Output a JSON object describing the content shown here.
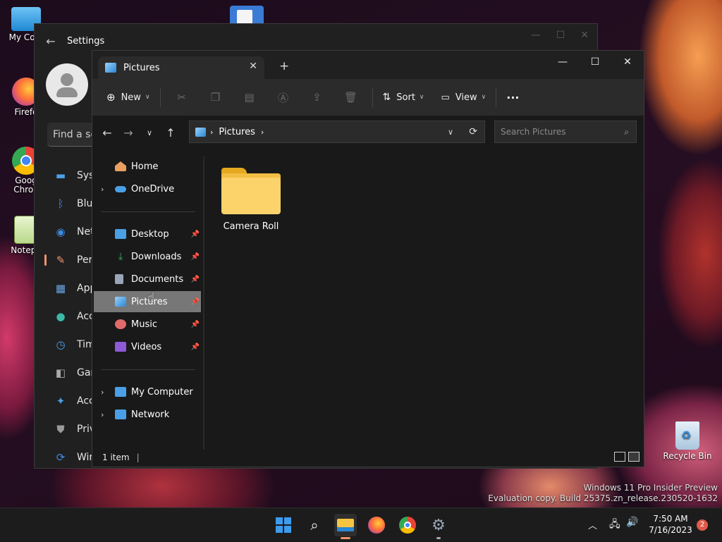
{
  "desktop": {
    "icons": [
      {
        "label": "My Com",
        "icon": "monitor-icon"
      },
      {
        "label": "Firefo",
        "icon": "firefox-icon"
      },
      {
        "label": "Goog Chron",
        "icon": "chrome-icon"
      },
      {
        "label": "Notepa",
        "icon": "notepad-icon"
      }
    ],
    "recycle_bin": "Recycle Bin",
    "watermark_line1": "Windows 11 Pro Insider Preview",
    "watermark_line2": "Evaluation copy. Build 25375.zn_release.230520-1632"
  },
  "settings": {
    "title": "Settings",
    "find_placeholder": "Find a se",
    "nav": [
      {
        "label": "Syst",
        "icon": "system-icon",
        "color": "#4aa0e6"
      },
      {
        "label": "Blue",
        "icon": "bluetooth-icon",
        "color": "#3b8be0"
      },
      {
        "label": "Net",
        "icon": "wifi-icon",
        "color": "#3b8be0"
      },
      {
        "label": "Pers",
        "icon": "brush-icon",
        "color": "#f0956c"
      },
      {
        "label": "App",
        "icon": "apps-icon",
        "color": "#6aa7e6"
      },
      {
        "label": "Acc",
        "icon": "account-icon",
        "color": "#3db8a8"
      },
      {
        "label": "Tim",
        "icon": "time-icon",
        "color": "#4aa0e6"
      },
      {
        "label": "Gan",
        "icon": "gaming-icon",
        "color": "#aaaaaa"
      },
      {
        "label": "Acc",
        "icon": "accessibility-icon",
        "color": "#4aa0e6"
      },
      {
        "label": "Priv",
        "icon": "shield-icon",
        "color": "#9a9a9a"
      },
      {
        "label": "Wir",
        "icon": "update-icon",
        "color": "#3b8be0"
      }
    ]
  },
  "explorer": {
    "tab_title": "Pictures",
    "toolbar": {
      "new_label": "New",
      "sort_label": "Sort",
      "view_label": "View",
      "more_label": "···"
    },
    "address": {
      "segments": [
        "Pictures"
      ],
      "search_placeholder": "Search Pictures"
    },
    "nav_pane": {
      "top": [
        {
          "label": "Home",
          "icon": "home-icon",
          "color": "#e8a060"
        },
        {
          "label": "OneDrive",
          "icon": "onedrive-icon",
          "color": "#4aa0e6"
        }
      ],
      "quick": [
        {
          "label": "Desktop",
          "icon": "desktop-icon",
          "color": "#4aa0e6"
        },
        {
          "label": "Downloads",
          "icon": "download-icon",
          "color": "#3bb56a"
        },
        {
          "label": "Documents",
          "icon": "documents-icon",
          "color": "#9aa6b8"
        },
        {
          "label": "Pictures",
          "icon": "pictures-icon",
          "color": "#4aa0e6"
        },
        {
          "label": "Music",
          "icon": "music-icon",
          "color": "#e26a6a"
        },
        {
          "label": "Videos",
          "icon": "videos-icon",
          "color": "#8e5ad8"
        }
      ],
      "bottom": [
        {
          "label": "My Computer",
          "icon": "computer-icon",
          "color": "#4aa0e6"
        },
        {
          "label": "Network",
          "icon": "network-icon",
          "color": "#4aa0e6"
        }
      ]
    },
    "items": [
      {
        "label": "Camera Roll",
        "icon": "folder-icon"
      }
    ],
    "status": "1 item"
  },
  "taskbar": {
    "time": "7:50 AM",
    "date": "7/16/2023",
    "notification_count": "2"
  }
}
